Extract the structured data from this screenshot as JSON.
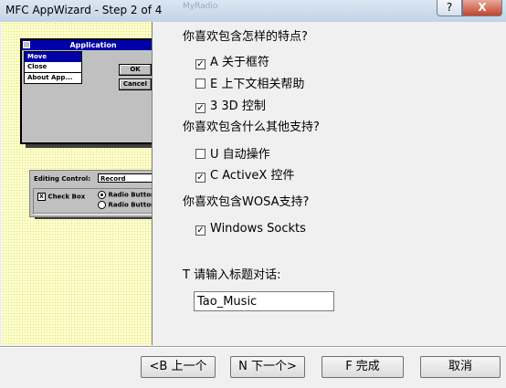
{
  "window": {
    "title": "MFC AppWizard - Step 2 of 4",
    "help_label": "?",
    "close_label": "X",
    "ghost_text": "MyRadio"
  },
  "preview": {
    "app_title": "Application",
    "menu_items": [
      "Move",
      "Close",
      "About App..."
    ],
    "ok_label": "OK",
    "cancel_label": "Cancel",
    "editing_label": "Editing Control:",
    "editing_value": "Record",
    "checkbox_label": "Check Box",
    "checkbox_mark": "X",
    "radio1_label": "Radio Button",
    "radio2_label": "Radio Button"
  },
  "questions": {
    "q1": "你喜欢包含怎样的特点?",
    "q2": "你喜欢包含什么其他支持?",
    "q3": "你喜欢包含WOSA支持?",
    "q4": "T 请输入标题对话:"
  },
  "options": [
    {
      "label": "A 关于框符",
      "checked": true
    },
    {
      "label": "E 上下文相关帮助",
      "checked": false
    },
    {
      "label": "3 3D 控制",
      "checked": true
    },
    {
      "label": "U 自动操作",
      "checked": false
    },
    {
      "label": "C ActiveX 控件",
      "checked": true
    },
    {
      "label": "Windows Sockts",
      "checked": true
    }
  ],
  "check_mark": "✓",
  "title_input": {
    "value": "Tao_Music"
  },
  "buttons": {
    "back": "<B 上一个",
    "next": "N 下一个>",
    "finish": "F 完成",
    "cancel": "取消"
  }
}
